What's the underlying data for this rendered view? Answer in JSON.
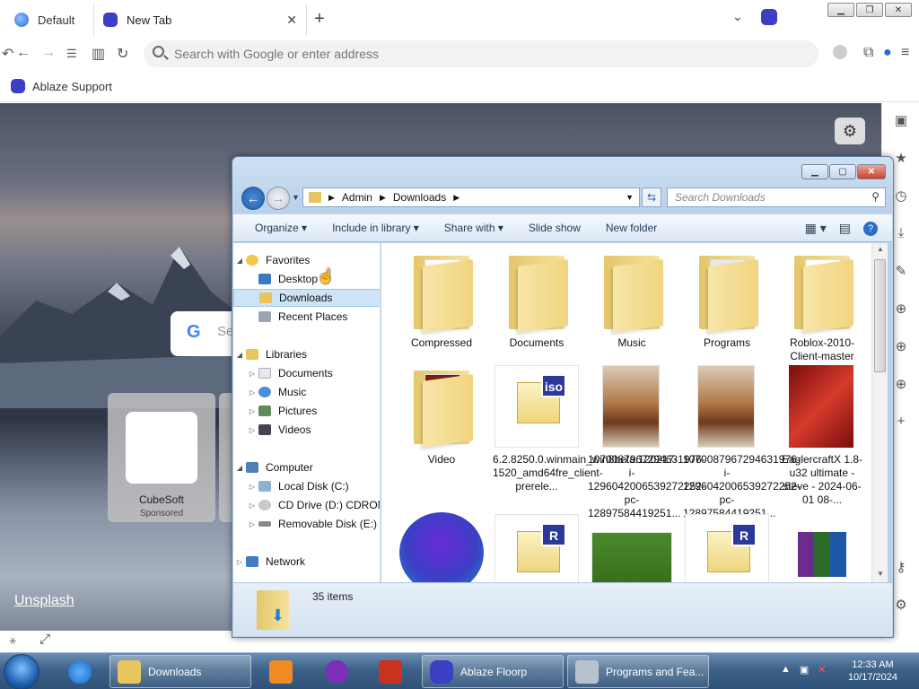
{
  "browser": {
    "tabs": [
      {
        "label": "Default",
        "icon": "globe-icon"
      },
      {
        "label": "New Tab",
        "icon": "ablaze-logo-icon",
        "active": true
      }
    ],
    "url_placeholder": "Search with Google or enter address",
    "bookmark": "Ablaze Support"
  },
  "newtab": {
    "google_placeholder": "Se",
    "tile_name": "CubeSoft",
    "tile_badge": "Sponsored",
    "credit": "Unsplash"
  },
  "explorer": {
    "breadcrumb": [
      "Admin",
      "Downloads"
    ],
    "search_placeholder": "Search Downloads",
    "toolbar": [
      "Organize",
      "Include in library",
      "Share with",
      "Slide show",
      "New folder"
    ],
    "nav": {
      "favorites": "Favorites",
      "fav_items": [
        "Desktop",
        "Downloads",
        "Recent Places"
      ],
      "libraries": "Libraries",
      "lib_items": [
        "Documents",
        "Music",
        "Pictures",
        "Videos"
      ],
      "computer": "Computer",
      "comp_items": [
        "Local Disk (C:)",
        "CD Drive (D:) CDROM",
        "Removable Disk (E:)"
      ],
      "network": "Network"
    },
    "items": [
      {
        "name": "Compressed",
        "kind": "folder"
      },
      {
        "name": "Documents",
        "kind": "folder"
      },
      {
        "name": "Music",
        "kind": "folder"
      },
      {
        "name": "Programs",
        "kind": "folder"
      },
      {
        "name": "Roblox-2010-Client-master",
        "kind": "folder"
      },
      {
        "name": "Video",
        "kind": "folder"
      },
      {
        "name": "6.2.8250.0.winmain_win8beta.120217-1520_amd64fre_client-prerele...",
        "kind": "iso"
      },
      {
        "name": "1070087967294631976-i-1296042006539272252-pc-12897584419251...",
        "kind": "image"
      },
      {
        "name": "1070087967294631976-i-1296042006539272252-pc-12897584419251...",
        "kind": "image"
      },
      {
        "name": "EaglercraftX 1.8-u32 ultimate - steve - 2024-06-01 08-...",
        "kind": "image"
      }
    ],
    "status_count": "35 items"
  },
  "taskbar": {
    "buttons": [
      "Downloads",
      "Ablaze Floorp",
      "Programs and Fea..."
    ],
    "time": "12:33 AM",
    "date": "10/17/2024"
  },
  "colors": {
    "accent": "#3b3fc4",
    "selection": "#cde4f7",
    "taskbar": "#3d6188"
  }
}
